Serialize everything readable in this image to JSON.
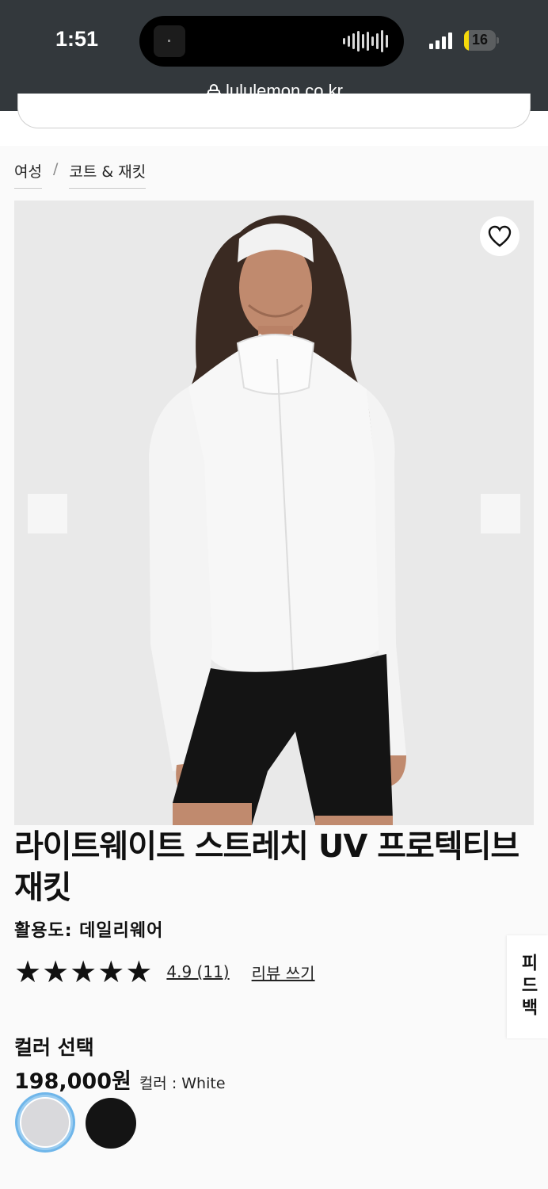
{
  "status_bar": {
    "time": "1:51",
    "battery": "16",
    "battery_level": 0.16
  },
  "browser": {
    "url": "lululemon.co.kr"
  },
  "breadcrumb": {
    "items": [
      "여성",
      "코트 & 재킷"
    ],
    "separator": "/"
  },
  "product": {
    "title": "라이트웨이트 스트레치 UV 프로텍티브 재킷",
    "activity": "활용도: 데일리웨어",
    "rating": {
      "stars": 5,
      "text": "4.9 (11)"
    },
    "write_review": "리뷰 쓰기",
    "side_tab": "피드백",
    "color_select_label": "컬러 선택",
    "price": "198,000원",
    "color_label": "컬러 : White",
    "swatches": [
      {
        "name": "White",
        "color": "#d9d9dc",
        "selected": true
      },
      {
        "name": "Black",
        "color": "#141414",
        "selected": false
      }
    ]
  },
  "colors": {
    "topbar": "#33383c",
    "selected_ring": "#6fb6ea"
  }
}
